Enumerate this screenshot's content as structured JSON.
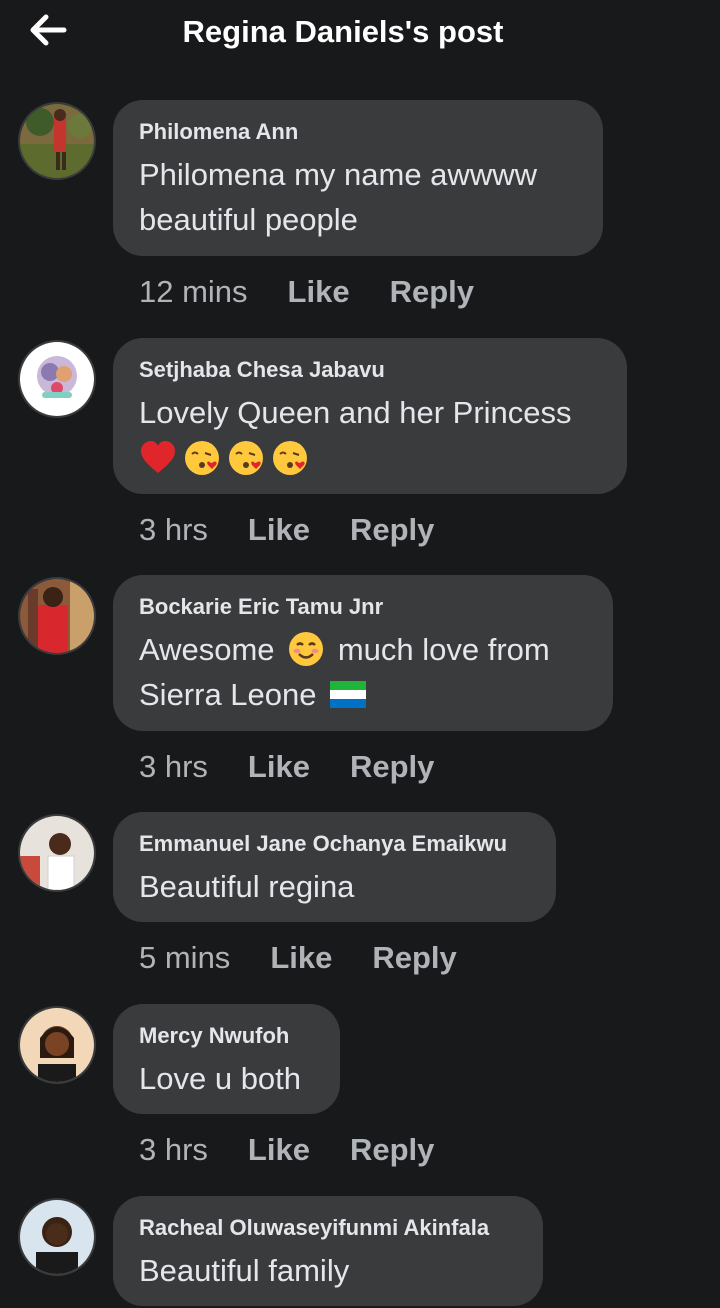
{
  "header": {
    "title": "Regina Daniels's post"
  },
  "comments": [
    {
      "author": "Philomena Ann",
      "text_lines": [
        "Philomena my name awwww",
        "beautiful people"
      ],
      "time": "12 mins",
      "like_label": "Like",
      "reply_label": "Reply"
    },
    {
      "author": "Setjhaba Chesa Jabavu",
      "text_lines": [
        "Lovely Queen and her Princess"
      ],
      "emojis": [
        "red-heart",
        "face-blowing-kiss",
        "face-blowing-kiss",
        "face-blowing-kiss"
      ],
      "time": "3 hrs",
      "like_label": "Like",
      "reply_label": "Reply"
    },
    {
      "author": "Bockarie Eric Tamu Jnr",
      "text_lines": [
        "Awesome",
        "much love from",
        "Sierra Leone"
      ],
      "emojis": [
        "smiling-face",
        "flag-sierra-leone"
      ],
      "time": "3 hrs",
      "like_label": "Like",
      "reply_label": "Reply"
    },
    {
      "author": "Emmanuel Jane Ochanya Emaikwu",
      "text_lines": [
        "Beautiful regina"
      ],
      "time": "5 mins",
      "like_label": "Like",
      "reply_label": "Reply"
    },
    {
      "author": "Mercy Nwufoh",
      "text_lines": [
        "Love u both"
      ],
      "time": "3 hrs",
      "like_label": "Like",
      "reply_label": "Reply"
    },
    {
      "author": "Racheal Oluwaseyifunmi Akinfala",
      "text_lines": [
        "Beautiful family"
      ]
    }
  ],
  "colors": {
    "background": "#18191a",
    "bubble": "#3a3b3c",
    "primary_text": "#e4e6eb",
    "secondary_text": "#b0b3b8"
  },
  "icons": {
    "back": "arrow-left-icon"
  }
}
